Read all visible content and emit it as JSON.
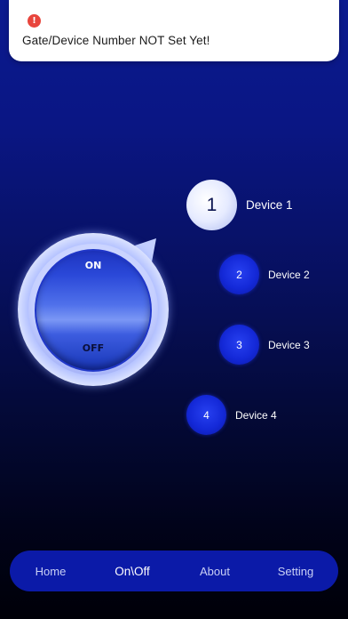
{
  "notification": {
    "icon": "alert-icon",
    "icon_glyph": "!",
    "message": "Gate/Device Number NOT Set Yet!"
  },
  "knob": {
    "on_label": "ON",
    "off_label": "OFF"
  },
  "devices": [
    {
      "number": "1",
      "label": "Device 1",
      "active": true
    },
    {
      "number": "2",
      "label": "Device 2",
      "active": false
    },
    {
      "number": "3",
      "label": "Device 3",
      "active": false
    },
    {
      "number": "4",
      "label": "Device 4",
      "active": false
    }
  ],
  "nav": {
    "items": [
      {
        "label": "Home",
        "active": false
      },
      {
        "label": "On\\Off",
        "active": true
      },
      {
        "label": "About",
        "active": false
      },
      {
        "label": "Setting",
        "active": false
      }
    ]
  },
  "colors": {
    "alert": "#e8453c",
    "nav_background": "#0b1aa8",
    "device_idle": "#1429d8"
  }
}
